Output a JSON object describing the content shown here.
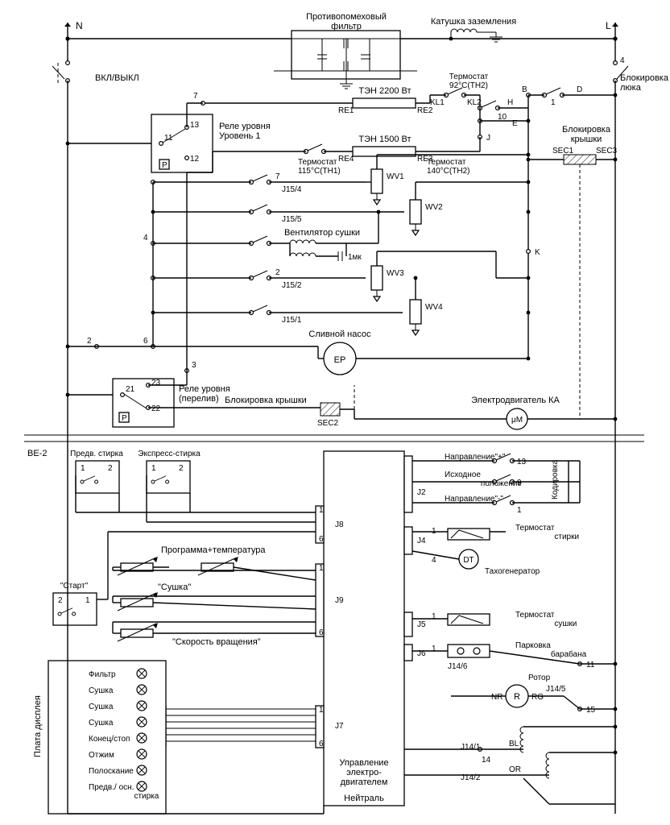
{
  "top": {
    "n": "N",
    "l": "L",
    "on_off": "ВКЛ/ВЫКЛ",
    "emi_filter": "Противопомеховый\nфильтр",
    "ground_coil": "Катушка заземления",
    "door_lock": "Блокировка\nлюка",
    "d": "D",
    "b": "B",
    "pin1": "1",
    "pin4": "4"
  },
  "level_relay1": {
    "title": "Реле уровня\nУровень 1",
    "p11": "11",
    "p12": "12",
    "p13": "13",
    "p": "P"
  },
  "heaters": {
    "h1_label": "ТЭН 2200 Вт",
    "h2_label": "ТЭН 1500 Вт",
    "kl1": "KL1",
    "kl2": "KL2",
    "re1": "RE1",
    "re2": "RE2",
    "re3": "RE3",
    "re4": "RE4",
    "therm92": "Термостат\n92°C(TH2)",
    "therm115": "Термостат\n115°C(TH1)",
    "therm140": "Термостат\n140°C(TH2)",
    "h": "H",
    "e": "E",
    "j": "J",
    "pin10": "10",
    "pin7": "7"
  },
  "valves": {
    "wv1": "WV1",
    "wv2": "WV2",
    "wv3": "WV3",
    "wv4": "WV4"
  },
  "jacks": {
    "j154": "J15/4",
    "j155": "J15/5",
    "j152": "J15/2",
    "j151": "J15/1"
  },
  "fan": {
    "label": "Вентилятор сушки",
    "cap": "1мк"
  },
  "pump": {
    "label": "Сливной насос",
    "sym": "EP"
  },
  "pins_left": {
    "p2": "2",
    "p4": "4",
    "p6": "6",
    "p7": "7",
    "p3": "3"
  },
  "k": "K",
  "lid_lock": {
    "label": "Блокировка\nкрышки",
    "sec1": "SEC1",
    "sec3": "SEC3"
  },
  "level_relay2": {
    "title": "Реле уровня\n(перелив)",
    "p21": "21",
    "p22": "22",
    "p23": "23",
    "p": "P"
  },
  "lid_lock2": {
    "label": "Блокировка крышки",
    "sec2": "SEC2"
  },
  "ka": {
    "label": "Электродвигатель КА",
    "sym": "μM"
  },
  "be2": "BE-2",
  "prewash": "Предв. стирка",
  "express": "Экспресс-стирка",
  "start": "\"Старт\"",
  "prog_temp": "Программа+температура",
  "dry": "\"Сушка\"",
  "spin_speed": "\"Скорость вращения\"",
  "conn": {
    "j2": "J2",
    "j4": "J4",
    "j5": "J5",
    "j6": "J6",
    "j7": "J7",
    "j8": "J8",
    "j9": "J9"
  },
  "j2_lines": {
    "dir_plus": "Направление\"+\"",
    "home": "Исходное\nположение",
    "dir_minus": "Направление\"-\"",
    "p13": "13",
    "p9": "9",
    "p1": "1"
  },
  "coding": "Кодировка",
  "wash_therm": "Термостат\nстирки",
  "dt": "DT",
  "tacho": "Тахогенератор",
  "dry_therm": "Термостат\nсушки",
  "drum_park": "Парковка\nбарабана",
  "j146": "J14/6",
  "j145": "J14/5",
  "j141": "J14/1",
  "j142": "J14/2",
  "p11b": "11",
  "p15": "15",
  "p14": "14",
  "rotor": "Ротор",
  "r": "R",
  "nr": "NR",
  "rg": "RG",
  "bl": "BL",
  "or": "OR",
  "motor_ctrl": "Управление\nэлектро-\nдвигателем",
  "neutral": "Нейтраль",
  "display_panel": "Плата дисплея",
  "leds": {
    "filter": "Фильтр",
    "dry1": "Сушка",
    "dry2": "Сушка",
    "dry3": "Сушка",
    "end": "Конец/стоп",
    "spin": "Отжим",
    "rinse": "Полоскание",
    "main": "Предв./ осн.\nстирка"
  },
  "small_pins": {
    "p1": "1",
    "p2": "2",
    "p3": "3",
    "p4": "4",
    "p6": "6",
    "p7": "7"
  }
}
